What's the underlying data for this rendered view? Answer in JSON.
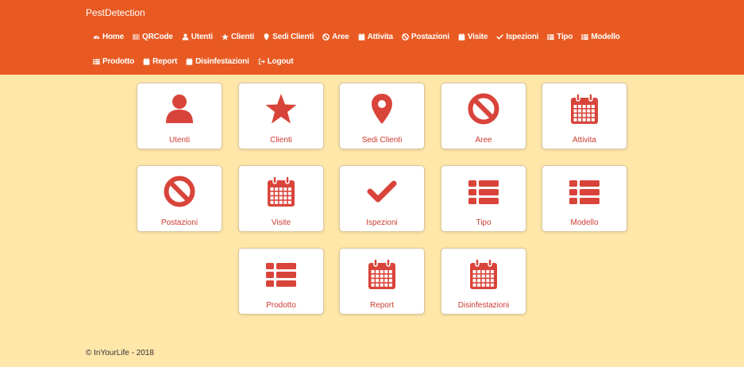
{
  "brand": "PestDetection",
  "nav": [
    {
      "label": "Home",
      "icon": "dashboard-icon"
    },
    {
      "label": "QRCode",
      "icon": "barcode-icon"
    },
    {
      "label": "Utenti",
      "icon": "user-icon"
    },
    {
      "label": "Clienti",
      "icon": "star-icon"
    },
    {
      "label": "Sedi Clienti",
      "icon": "map-marker-icon"
    },
    {
      "label": "Aree",
      "icon": "ban-icon"
    },
    {
      "label": "Attivita",
      "icon": "calendar-icon"
    },
    {
      "label": "Postazioni",
      "icon": "ban-icon"
    },
    {
      "label": "Visite",
      "icon": "calendar-icon"
    },
    {
      "label": "Ispezioni",
      "icon": "check-icon"
    },
    {
      "label": "Tipo",
      "icon": "list-icon"
    },
    {
      "label": "Modello",
      "icon": "list-icon"
    },
    {
      "label": "Prodotto",
      "icon": "list-icon"
    },
    {
      "label": "Report",
      "icon": "calendar-icon"
    },
    {
      "label": "Disinfestazioni",
      "icon": "calendar-icon"
    },
    {
      "label": "Logout",
      "icon": "logout-icon"
    }
  ],
  "tiles": [
    {
      "label": "Utenti",
      "icon": "user-icon"
    },
    {
      "label": "Clienti",
      "icon": "star-icon"
    },
    {
      "label": "Sedi Clienti",
      "icon": "map-marker-icon"
    },
    {
      "label": "Aree",
      "icon": "ban-icon"
    },
    {
      "label": "Attivita",
      "icon": "calendar-icon"
    },
    {
      "label": "Postazioni",
      "icon": "ban-icon"
    },
    {
      "label": "Visite",
      "icon": "calendar-icon"
    },
    {
      "label": "Ispezioni",
      "icon": "check-icon"
    },
    {
      "label": "Tipo",
      "icon": "list-icon"
    },
    {
      "label": "Modello",
      "icon": "list-icon"
    },
    {
      "label": "Prodotto",
      "icon": "list-icon"
    },
    {
      "label": "Report",
      "icon": "calendar-icon"
    },
    {
      "label": "Disinfestazioni",
      "icon": "calendar-icon"
    }
  ],
  "footer": "© InYourLife - 2018",
  "colors": {
    "navbar": "#e85a22",
    "background": "#ffe6a9",
    "accent": "#d9443a"
  }
}
